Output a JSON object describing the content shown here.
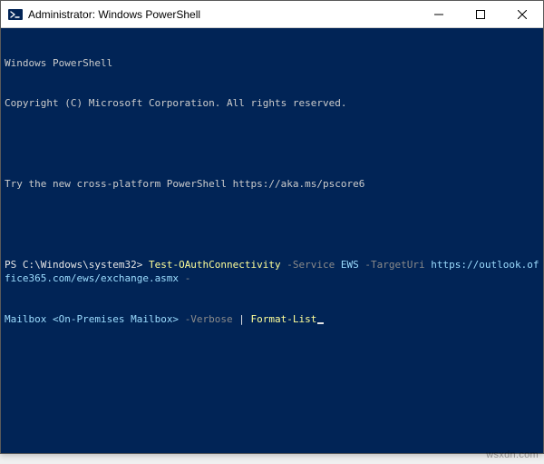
{
  "window": {
    "title": "Administrator: Windows PowerShell"
  },
  "terminal": {
    "banner_line1": "Windows PowerShell",
    "banner_line2": "Copyright (C) Microsoft Corporation. All rights reserved.",
    "banner_line3": "Try the new cross-platform PowerShell https://aka.ms/pscore6",
    "prompt": "PS C:\\Windows\\system32> ",
    "command": {
      "cmdlet": "Test-OAuthConnectivity",
      "param_service": "-Service",
      "val_service": "EWS",
      "param_targeturi": "-TargetUri",
      "val_targeturi": "https://outlook.office365.com/ews/exchange.asmx",
      "dash_trailing": "-",
      "line2_prefix": "Mailbox ",
      "val_mailbox": "<On-Premises Mailbox>",
      "param_verbose": "-Verbose",
      "pipe": " | ",
      "cmdlet2": "Format-List"
    }
  },
  "watermark": "wsxdn.com"
}
